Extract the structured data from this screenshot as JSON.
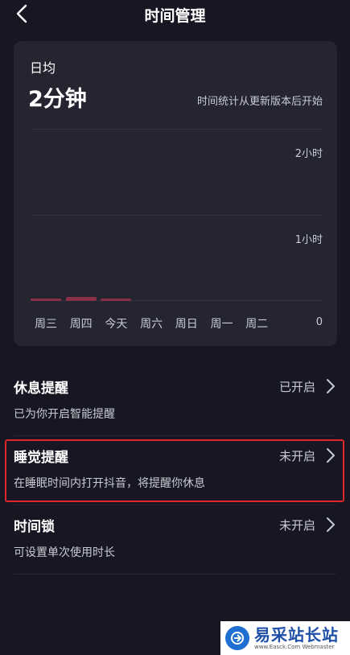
{
  "header": {
    "title": "时间管理"
  },
  "stats": {
    "avg_label": "日均",
    "avg_value": "2分钟",
    "note": "时间统计从更新版本后开始"
  },
  "chart_data": {
    "type": "bar",
    "categories": [
      "周三",
      "周四",
      "今天",
      "周六",
      "周日",
      "周一",
      "周二"
    ],
    "values": [
      1,
      2,
      1,
      0,
      0,
      0,
      0
    ],
    "value_unit": "分钟",
    "ylim": [
      0,
      120
    ],
    "y_ticks": [
      {
        "value": 120,
        "label": "2小时"
      },
      {
        "value": 60,
        "label": "1小时"
      },
      {
        "value": 0,
        "label": "0"
      }
    ],
    "bar_color": "#8a2f48",
    "grid": true
  },
  "settings": [
    {
      "title": "休息提醒",
      "subtitle": "已为你开启智能提醒",
      "status": "已开启"
    },
    {
      "title": "睡觉提醒",
      "subtitle": "在睡眠时间内打开抖音，将提醒你休息",
      "status": "未开启"
    },
    {
      "title": "时间锁",
      "subtitle": "可设置单次使用时长",
      "status": "未开启"
    }
  ],
  "watermark": {
    "name": "易采站长站",
    "url": "www.Easck.Com Webmaster"
  },
  "colors": {
    "background": "#161722",
    "card": "#242531",
    "bar": "#8a2f48",
    "highlight": "#e0262c"
  }
}
